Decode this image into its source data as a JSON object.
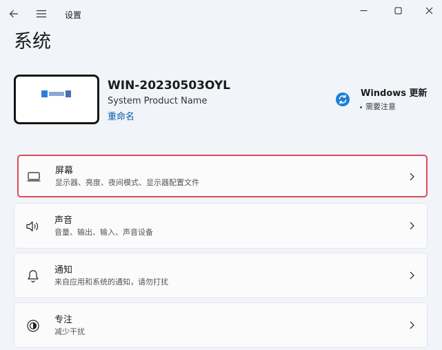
{
  "header": {
    "app_title": "设置",
    "back_icon": "back-arrow-icon",
    "menu_icon": "hamburger-menu-icon"
  },
  "page": {
    "title": "系统"
  },
  "device": {
    "name": "WIN-20230503OYL",
    "model": "System Product Name",
    "rename_label": "重命名"
  },
  "windows_update": {
    "title": "Windows 更新",
    "status": "需要注意",
    "icon": "sync-icon",
    "accent": "#1a7fd8"
  },
  "settings": [
    {
      "title": "屏幕",
      "description": "显示器、亮度、夜间模式、显示器配置文件",
      "icon": "monitor-icon",
      "selected": true
    },
    {
      "title": "声音",
      "description": "音量、输出、输入、声音设备",
      "icon": "speaker-icon",
      "selected": false
    },
    {
      "title": "通知",
      "description": "来自应用和系统的通知，请勿打扰",
      "icon": "bell-icon",
      "selected": false
    },
    {
      "title": "专注",
      "description": "减少干扰",
      "icon": "focus-icon",
      "selected": false
    }
  ],
  "colors": {
    "background": "#f1f4f9",
    "card": "#fbfbfc",
    "link": "#0b5aa8",
    "selection_outline": "#e04a5a"
  }
}
